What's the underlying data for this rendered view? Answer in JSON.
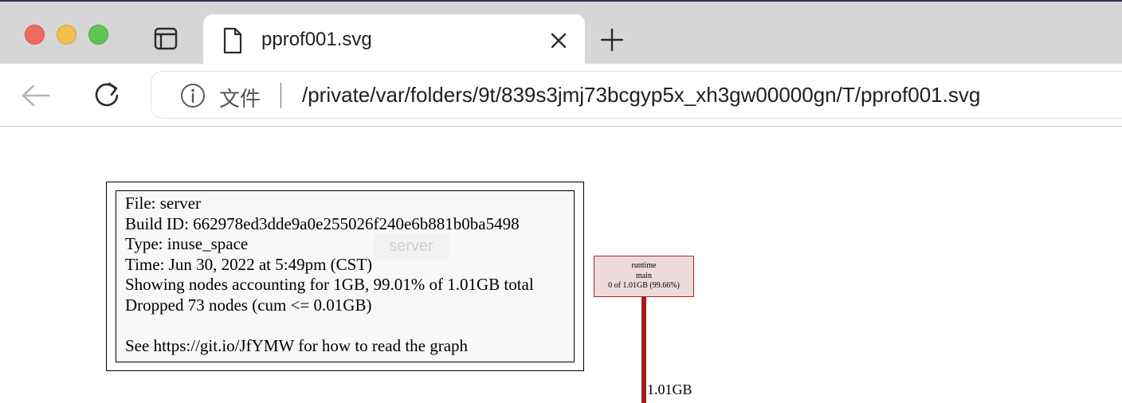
{
  "tab": {
    "title": "pprof001.svg"
  },
  "toolbar": {
    "omnibox_label": "文件",
    "url": "/private/var/folders/9t/839s3jmj73bcgyp5x_xh3gw00000gn/T/pprof001.svg"
  },
  "legend": {
    "lines": [
      "File: server",
      "Build ID: 662978ed3dde9a0e255026f240e6b881b0ba5498",
      "Type: inuse_space",
      "Time: Jun 30, 2022 at 5:49pm (CST)",
      "Showing nodes accounting for 1GB, 99.01% of 1.01GB total",
      "Dropped 73 nodes (cum <= 0.01GB)",
      "",
      "See https://git.io/JfYMW for how to read the graph"
    ]
  },
  "overlay": {
    "label": "server"
  },
  "graph": {
    "node": {
      "package": "runtime",
      "function": "main",
      "value": "0 of 1.01GB (99.66%)",
      "fill_color": "#eddada",
      "border_color": "#b22222"
    },
    "edge": {
      "label": "1.01GB",
      "color": "#a31c1c"
    }
  },
  "icons": {
    "window_controls": [
      "close-traffic-light",
      "minimize-traffic-light",
      "zoom-traffic-light"
    ],
    "sidebar": "sidebar-icon",
    "tab_page": "page-icon",
    "tab_close": "close-icon",
    "new_tab": "plus-icon",
    "back": "back-arrow-icon",
    "reload": "reload-icon",
    "info": "info-icon"
  }
}
